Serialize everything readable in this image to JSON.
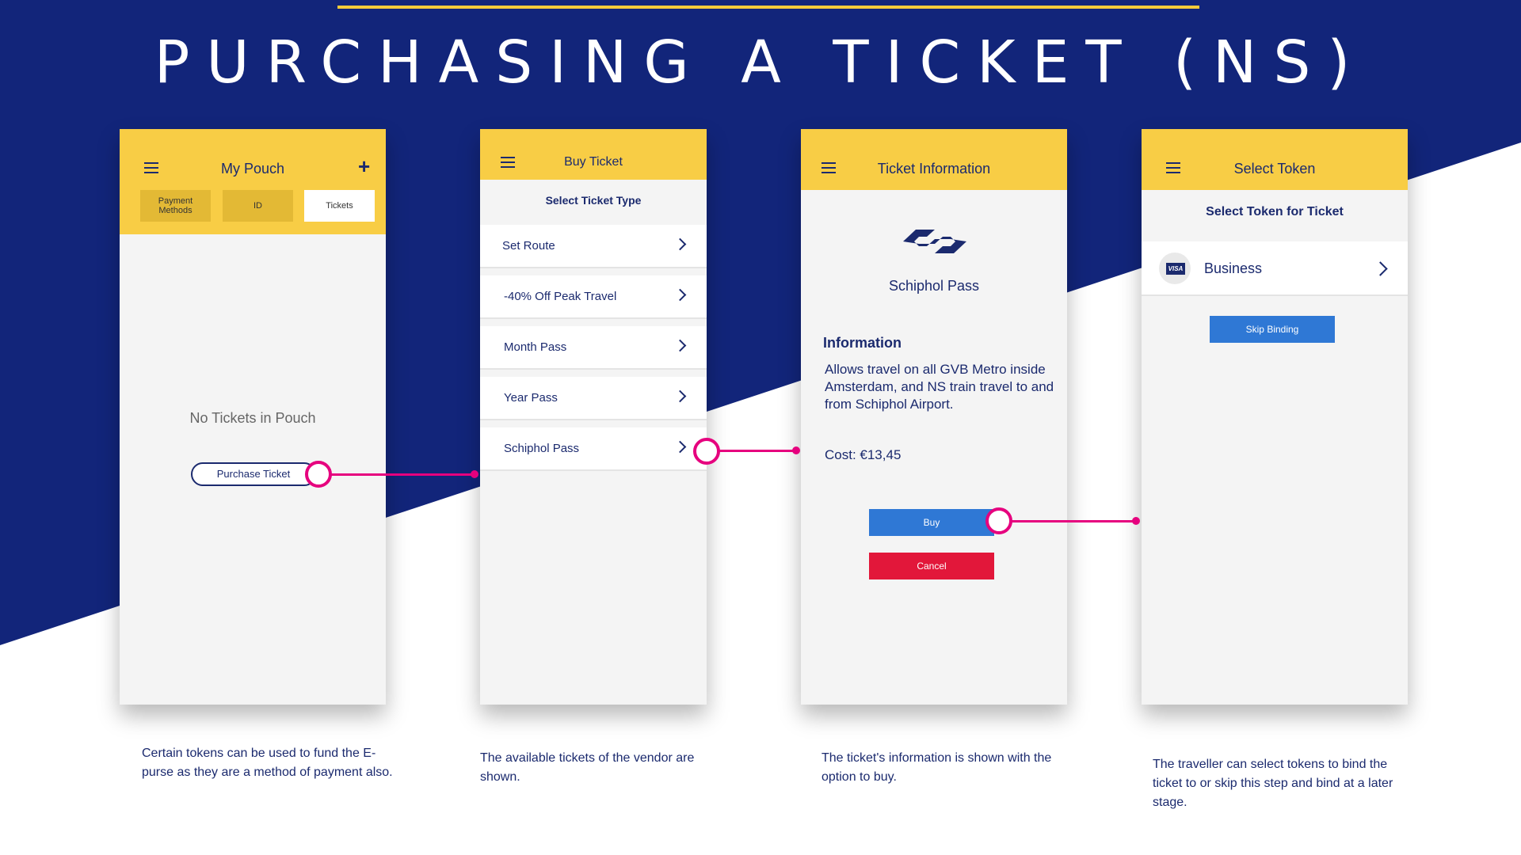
{
  "page_title": "PURCHASING A TICKET (NS)",
  "colors": {
    "navy": "#12257a",
    "yellow": "#f8cd45",
    "magenta": "#e6007e",
    "buy_blue": "#2f78d5",
    "cancel_red": "#e2173a"
  },
  "screen1": {
    "title": "My Pouch",
    "add_icon": "plus-icon",
    "tabs": [
      "Payment\nMethods",
      "ID",
      "Tickets"
    ],
    "selected_tab": "Tickets",
    "empty_message": "No Tickets in Pouch",
    "purchase_button": "Purchase Ticket",
    "caption": "Certain tokens can be used to fund the E-purse as they are a method of payment also."
  },
  "screen2": {
    "title": "Buy Ticket",
    "subtitle": "Select Ticket Type",
    "items": [
      "Set Route",
      "-40% Off Peak Travel",
      "Month Pass",
      "Year Pass",
      "Schiphol Pass"
    ],
    "caption": "The available tickets of the vendor are shown."
  },
  "screen3": {
    "title": "Ticket Information",
    "logo": "ns-logo",
    "ticket_name": "Schiphol Pass",
    "info_heading": "Information",
    "info_text": "Allows travel on all GVB Metro inside Amsterdam, and NS train travel to and from Schiphol Airport.",
    "cost": "Cost: €13,45",
    "buy_button": "Buy",
    "cancel_button": "Cancel",
    "caption": "The ticket's information is shown with the option to buy."
  },
  "screen4": {
    "title": "Select Token",
    "subtitle": "Select Token for Ticket",
    "token_badge": "VISA",
    "token_name": "Business",
    "skip_button": "Skip Binding",
    "caption": "The traveller can select tokens to bind the ticket to or skip this step and bind at a later stage."
  }
}
